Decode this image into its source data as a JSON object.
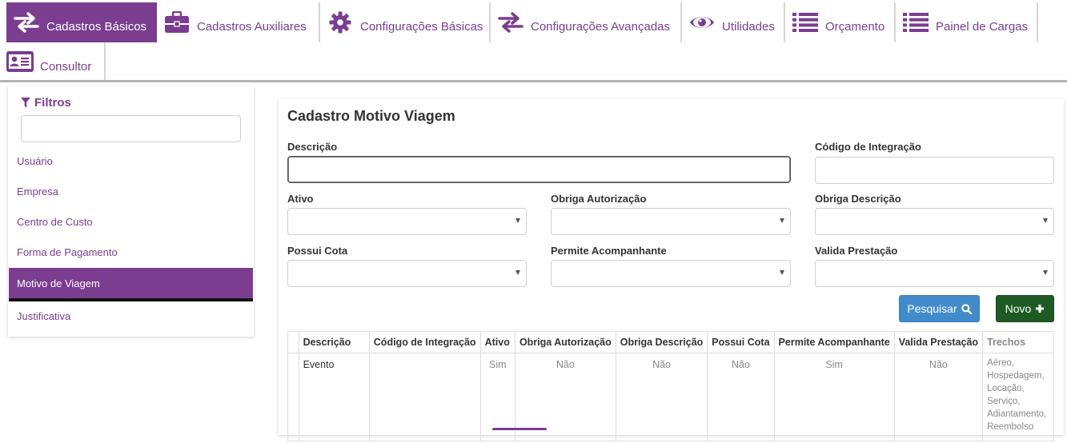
{
  "nav": {
    "tabs": [
      {
        "label": "Cadastros Básicos",
        "icon": "arrows-exchange-icon",
        "active": true
      },
      {
        "label": "Cadastros Auxiliares",
        "icon": "briefcase-icon"
      },
      {
        "label": "Configurações Básicas",
        "icon": "gear-icon"
      },
      {
        "label": "Configurações Avançadas",
        "icon": "arrows-exchange-icon"
      },
      {
        "label": "Utilidades",
        "icon": "eye-icon"
      },
      {
        "label": "Orçamento",
        "icon": "list-icon"
      },
      {
        "label": "Painel de Cargas",
        "icon": "list-icon"
      },
      {
        "label": "Consultor",
        "icon": "id-card-icon"
      }
    ]
  },
  "sidebar": {
    "filter_title": "Filtros",
    "filter_value": "",
    "items": [
      {
        "label": "Usuário"
      },
      {
        "label": "Empresa"
      },
      {
        "label": "Centro de Custo"
      },
      {
        "label": "Forma de Pagamento"
      },
      {
        "label": "Motivo de Viagem",
        "active": true
      },
      {
        "label": "Justificativa"
      }
    ]
  },
  "form": {
    "title": "Cadastro Motivo Viagem",
    "descricao_label": "Descrição",
    "descricao_value": "",
    "codigo_label": "Código de Integração",
    "codigo_value": "",
    "ativo_label": "Ativo",
    "obriga_autorizacao_label": "Obriga Autorização",
    "obriga_descricao_label": "Obriga Descrição",
    "possui_cota_label": "Possui Cota",
    "permite_acompanhante_label": "Permite Acompanhante",
    "valida_prestacao_label": "Valida Prestação",
    "search_button": "Pesquisar",
    "new_button": "Novo"
  },
  "table": {
    "headers": [
      "Descrição",
      "Código de Integração",
      "Ativo",
      "Obriga Autorização",
      "Obriga Descrição",
      "Possui Cota",
      "Permite Acompanhante",
      "Valida Prestação",
      "Trechos"
    ],
    "rows": [
      {
        "descricao": "Evento",
        "codigo": "",
        "ativo": "Sim",
        "obriga_autorizacao": "Não",
        "obriga_descricao": "Não",
        "possui_cota": "Não",
        "permite_acompanhante": "Sim",
        "valida_prestacao": "Não",
        "trechos": [
          "Aéreo,",
          "Hospedagem,",
          "Locação,",
          "Serviço,",
          "Adiantamento,",
          "Reembolso"
        ]
      }
    ]
  },
  "colors": {
    "brand": "#7a3d8f",
    "search_button": "#428bca",
    "new_button": "#1e5a23"
  }
}
